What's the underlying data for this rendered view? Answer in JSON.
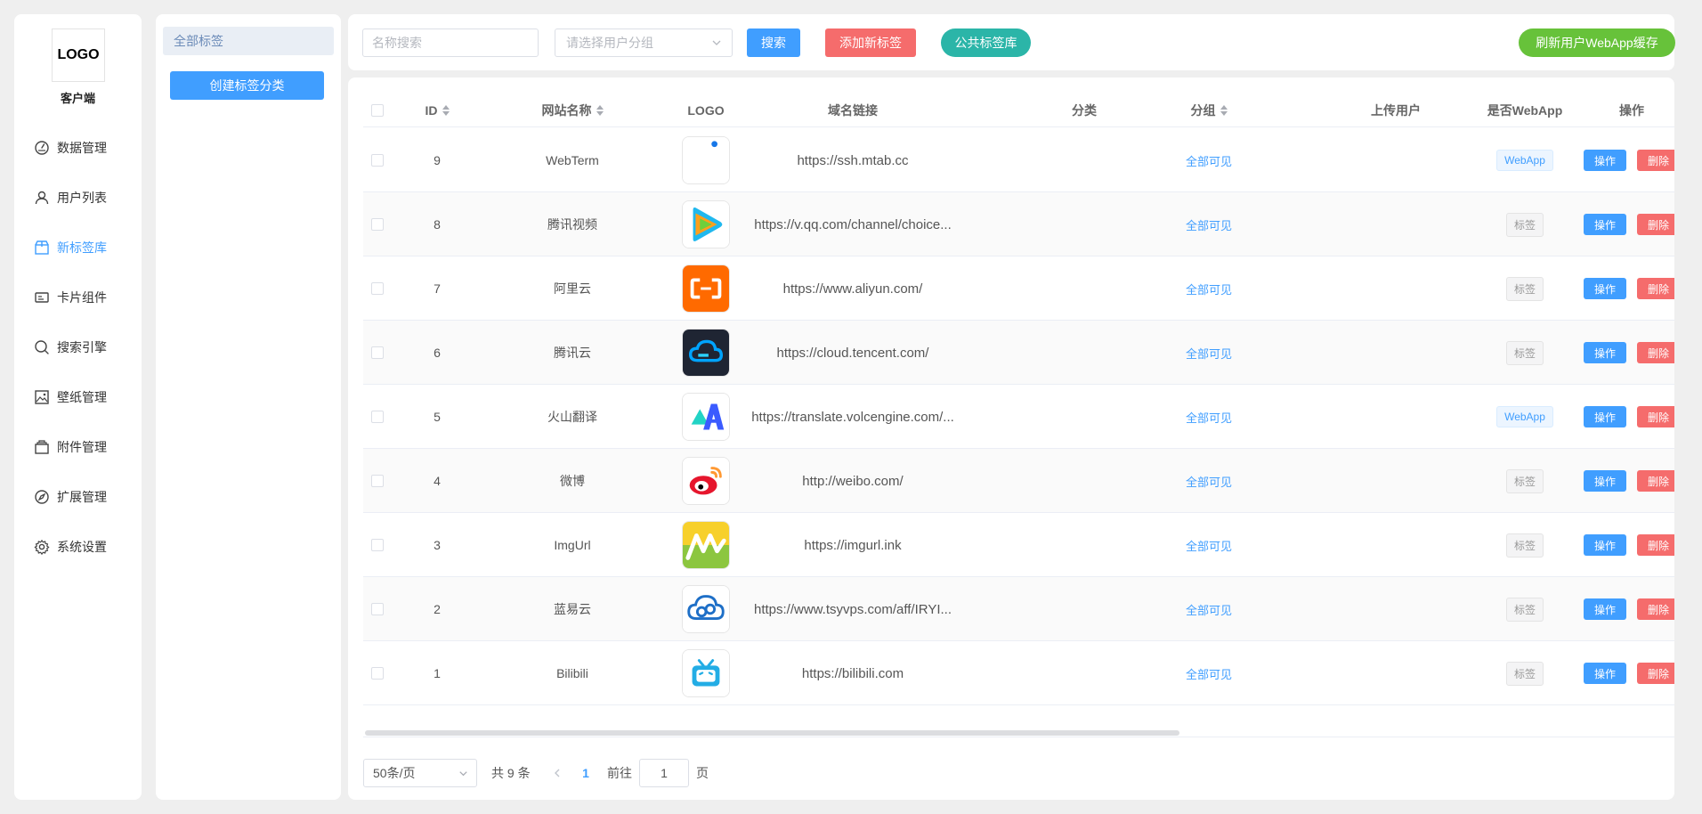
{
  "nav": {
    "logo_text": "LOGO",
    "client_label": "客户端",
    "items": [
      {
        "label": "数据管理",
        "icon": "dashboard-icon"
      },
      {
        "label": "用户列表",
        "icon": "user-icon"
      },
      {
        "label": "新标签库",
        "icon": "box-icon",
        "active": true
      },
      {
        "label": "卡片组件",
        "icon": "card-icon"
      },
      {
        "label": "搜索引擎",
        "icon": "search-icon"
      },
      {
        "label": "壁纸管理",
        "icon": "image-icon"
      },
      {
        "label": "附件管理",
        "icon": "folder-icon"
      },
      {
        "label": "扩展管理",
        "icon": "compass-icon"
      },
      {
        "label": "系统设置",
        "icon": "gear-icon"
      }
    ]
  },
  "categories": {
    "all_label": "全部标签",
    "create_label": "创建标签分类"
  },
  "toolbar": {
    "name_placeholder": "名称搜索",
    "group_placeholder": "请选择用户分组",
    "search_label": "搜索",
    "add_label": "添加新标签",
    "public_label": "公共标签库",
    "refresh_label": "刷新用户WebApp缓存"
  },
  "table": {
    "columns": {
      "id": "ID",
      "name": "网站名称",
      "logo": "LOGO",
      "url": "域名链接",
      "category": "分类",
      "group": "分组",
      "uploader": "上传用户",
      "webapp": "是否WebApp",
      "ops": "操作"
    },
    "edit_label": "操作",
    "delete_label": "删除",
    "rows": [
      {
        "id": "9",
        "name": "WebTerm",
        "logo": "webterm-logo-icon",
        "url": "https://ssh.mtab.cc",
        "group": "全部可见",
        "type": "WebApp"
      },
      {
        "id": "8",
        "name": "腾讯视频",
        "logo": "tencent-video-logo-icon",
        "url": "https://v.qq.com/channel/choice...",
        "group": "全部可见",
        "type": "标签"
      },
      {
        "id": "7",
        "name": "阿里云",
        "logo": "aliyun-logo-icon",
        "url": "https://www.aliyun.com/",
        "group": "全部可见",
        "type": "标签"
      },
      {
        "id": "6",
        "name": "腾讯云",
        "logo": "tencent-cloud-logo-icon",
        "url": "https://cloud.tencent.com/",
        "group": "全部可见",
        "type": "标签"
      },
      {
        "id": "5",
        "name": "火山翻译",
        "logo": "volcengine-translate-logo-icon",
        "url": "https://translate.volcengine.com/...",
        "group": "全部可见",
        "type": "WebApp"
      },
      {
        "id": "4",
        "name": "微博",
        "logo": "weibo-logo-icon",
        "url": "http://weibo.com/",
        "group": "全部可见",
        "type": "标签"
      },
      {
        "id": "3",
        "name": "ImgUrl",
        "logo": "imgurl-logo-icon",
        "url": "https://imgurl.ink",
        "group": "全部可见",
        "type": "标签"
      },
      {
        "id": "2",
        "name": "蓝易云",
        "logo": "tsyvps-logo-icon",
        "url": "https://www.tsyvps.com/aff/IRYI...",
        "group": "全部可见",
        "type": "标签"
      },
      {
        "id": "1",
        "name": "Bilibili",
        "logo": "bilibili-logo-icon",
        "url": "https://bilibili.com",
        "group": "全部可见",
        "type": "标签"
      }
    ]
  },
  "pagination": {
    "page_size": "50条/页",
    "total": "共 9 条",
    "current": "1",
    "goto_label": "前往",
    "goto_value": "1",
    "page_label": "页"
  },
  "colors": {
    "primary": "#409eff",
    "danger": "#f56c6c",
    "success": "#67c23a",
    "teal": "#2bb5a8"
  }
}
